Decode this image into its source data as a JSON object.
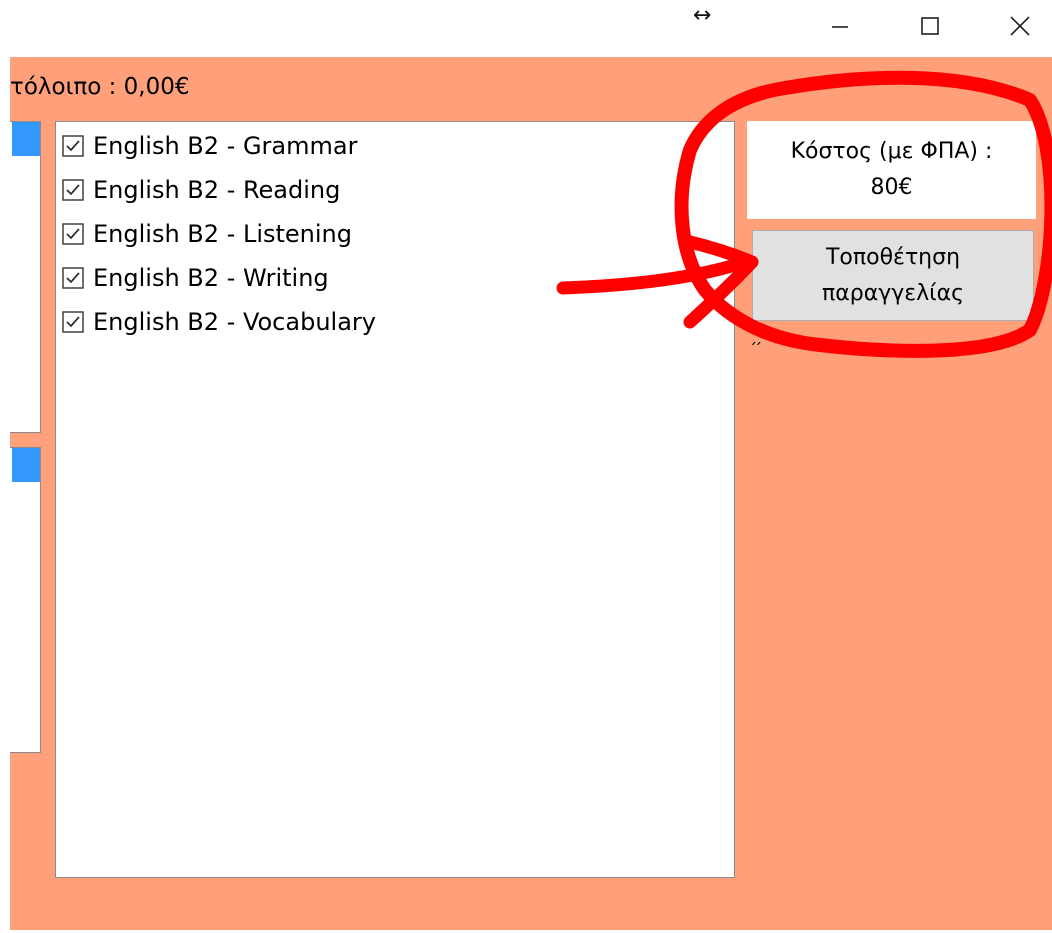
{
  "window": {
    "resize_glyph": "↔",
    "minimize_icon": "minimize-icon",
    "maximize_icon": "maximize-icon",
    "close_icon": "close-icon"
  },
  "balance_label": "τόλοιπο : 0,00€",
  "courses": [
    {
      "label": "English B2 - Grammar",
      "checked": true
    },
    {
      "label": "English B2 - Reading",
      "checked": true
    },
    {
      "label": "English B2 - Listening",
      "checked": true
    },
    {
      "label": "English B2 - Writing",
      "checked": true
    },
    {
      "label": "English B2 - Vocabulary",
      "checked": true
    }
  ],
  "cost": {
    "line1": "Κόστος (με ΦΠΑ) :",
    "line2": "80€"
  },
  "order_button": {
    "line1": "Τοποθέτηση",
    "line2": "παραγγελίας"
  },
  "stray_text": "́ ́",
  "colors": {
    "background": "#ffa07a",
    "selection": "#3399ff",
    "annotation": "#ff0000",
    "button": "#e1e1e1"
  }
}
